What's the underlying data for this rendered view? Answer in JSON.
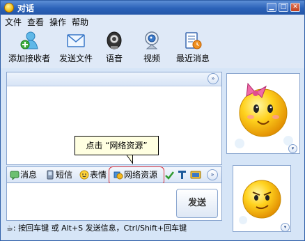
{
  "window": {
    "title": "对话",
    "minimize": "0",
    "maximize": "1",
    "close": "r"
  },
  "menu": [
    "文件",
    "查看",
    "操作",
    "帮助"
  ],
  "toolbar": [
    {
      "label": "添加接收者",
      "icon": "add-contact-icon"
    },
    {
      "label": "发送文件",
      "icon": "envelope-icon"
    },
    {
      "label": "语音",
      "icon": "speaker-icon"
    },
    {
      "label": "视频",
      "icon": "webcam-icon"
    },
    {
      "label": "最近消息",
      "icon": "recent-messages-icon"
    }
  ],
  "history": {
    "scroll_label": "»"
  },
  "tooltip": "点击 “网络资源”",
  "input_toolbar": {
    "items": [
      {
        "label": "消息",
        "icon": "message-icon"
      },
      {
        "label": "短信",
        "icon": "sms-icon"
      },
      {
        "label": "表情",
        "icon": "emoticon-icon"
      },
      {
        "label": "网络资源",
        "icon": "web-resource-icon"
      }
    ],
    "more_label": "»"
  },
  "send_button": "发送",
  "status_text": "按回车键 或 Alt+S 发送信息，Ctrl/Shift+回车键",
  "colors": {
    "title_bar": "#2b62b8",
    "window_bg": "#d6e5f7",
    "highlight": "#d8303a",
    "tooltip_bg": "#ffffe1"
  }
}
